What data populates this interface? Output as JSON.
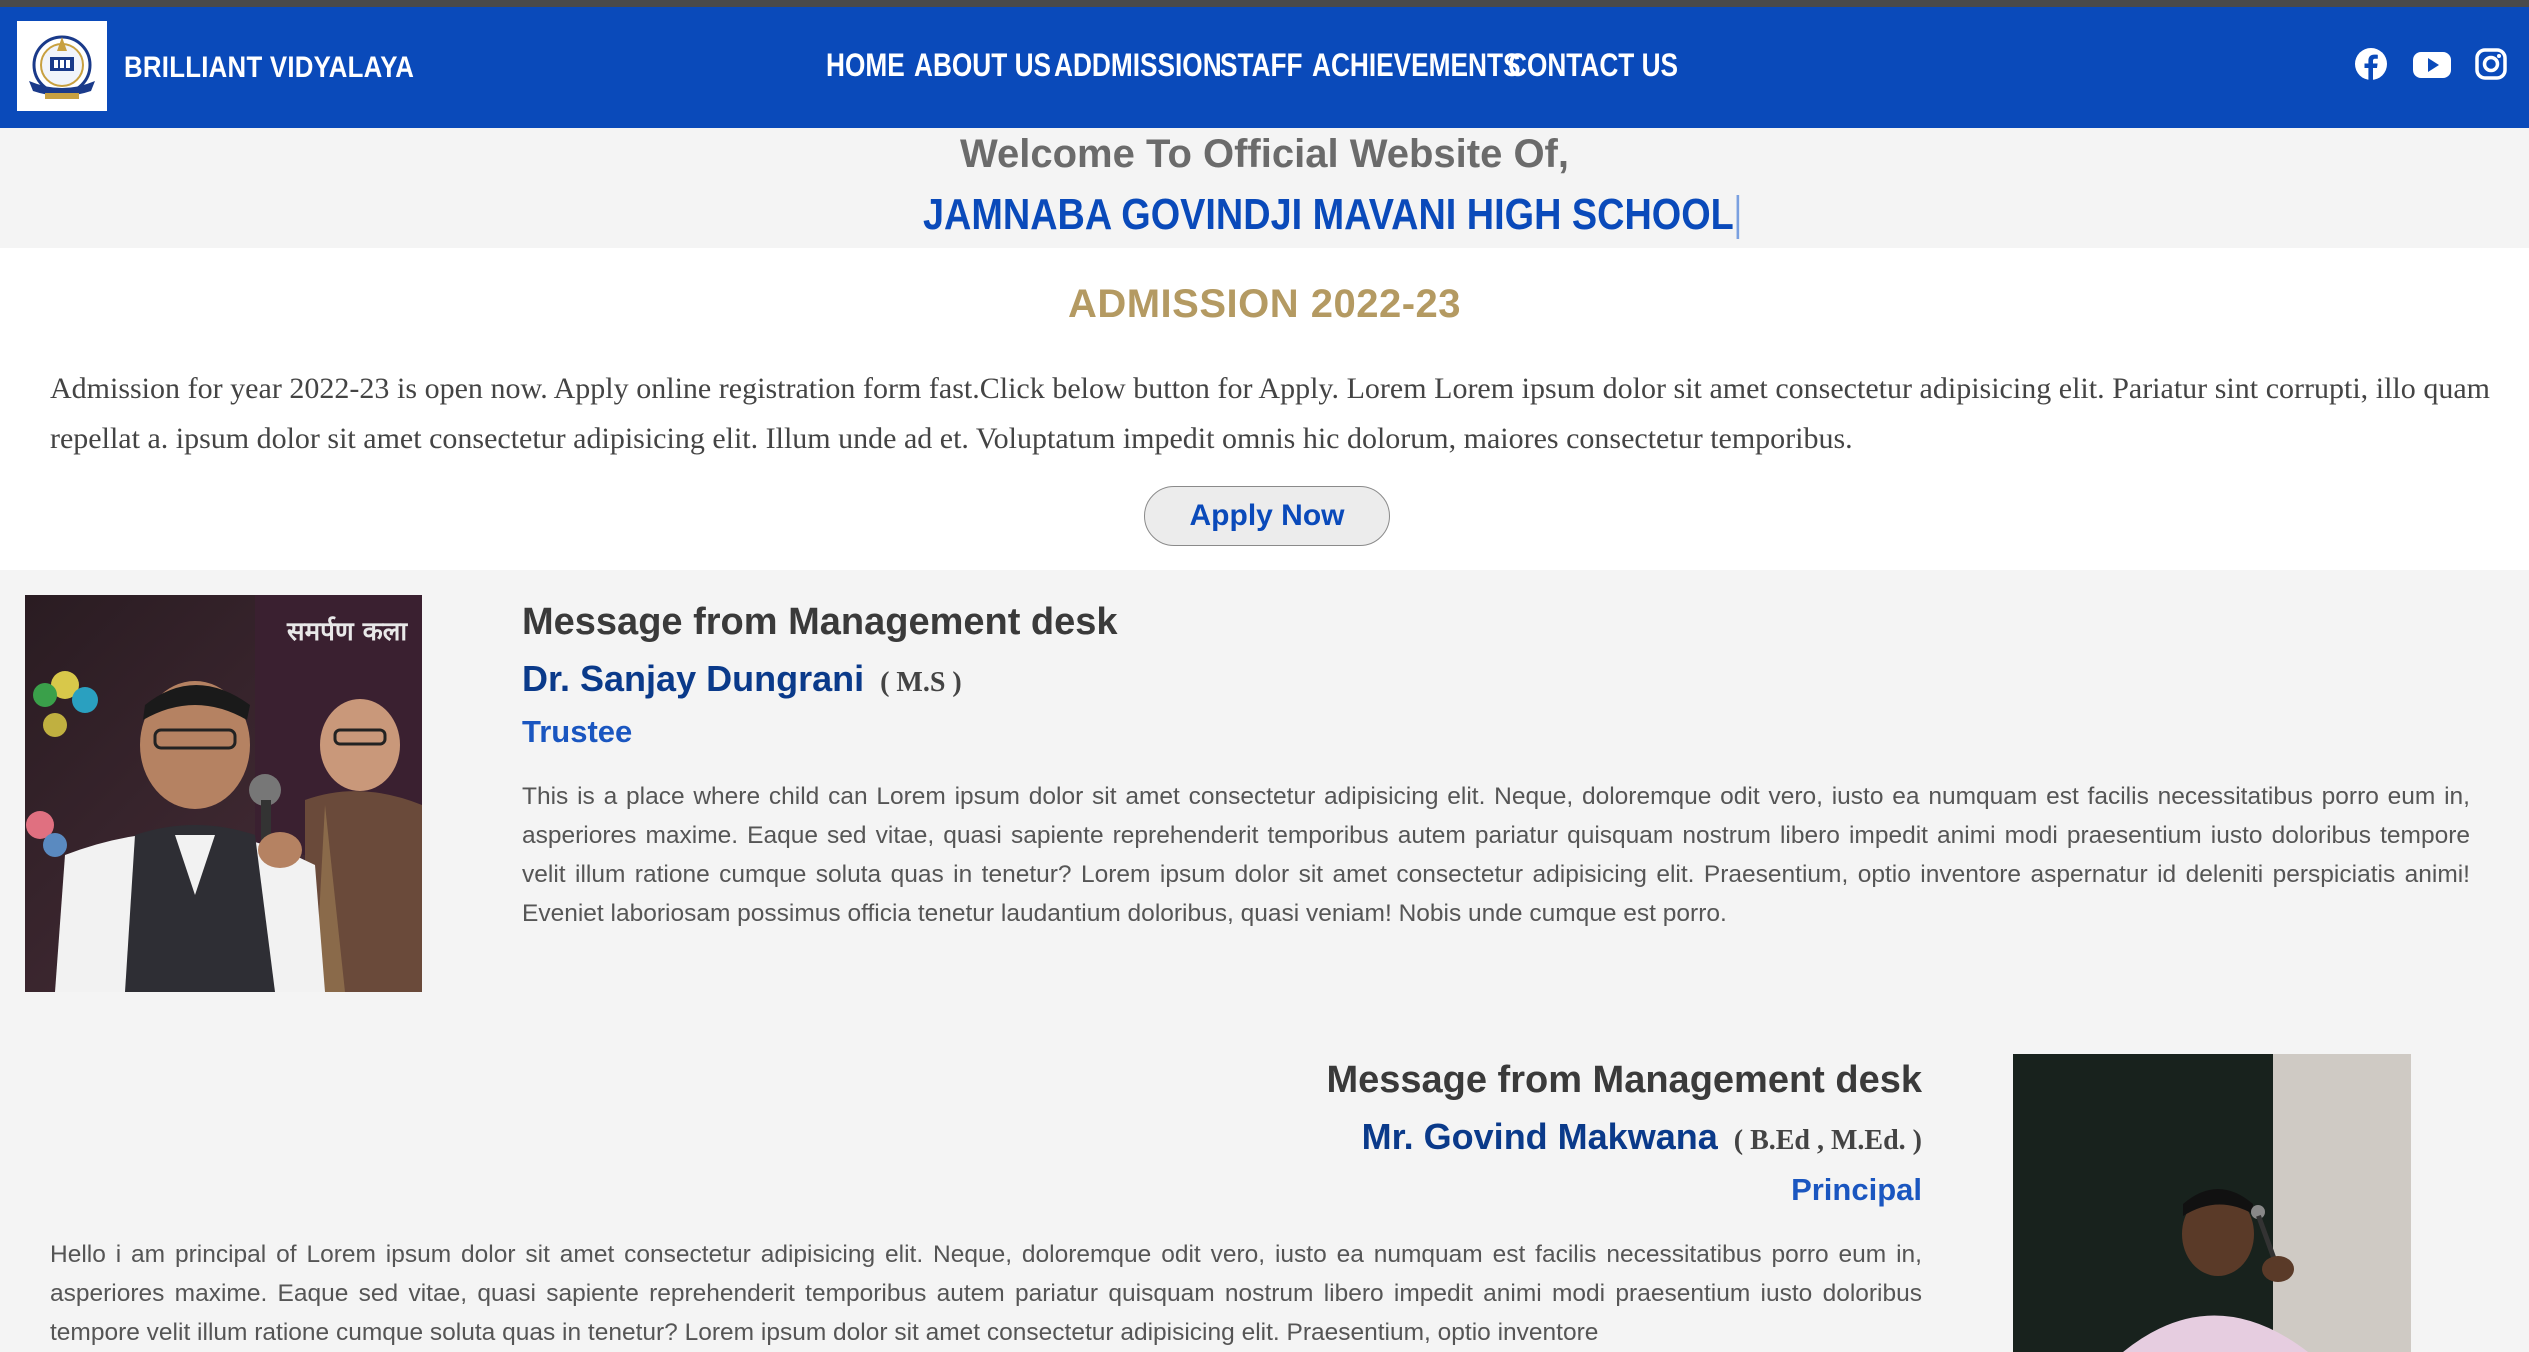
{
  "navbar": {
    "brand": "BRILLIANT VIDYALAYA",
    "logo_icon": "school-crest-logo",
    "menu": [
      "HOME",
      "ABOUT US",
      "ADDMISSION",
      "STAFF",
      "ACHIEVEMENTS",
      "CONTACT US"
    ],
    "social_icons": [
      "facebook-icon",
      "youtube-icon",
      "instagram-icon"
    ],
    "bg_color": "#0a4aba"
  },
  "welcome": {
    "line1": "Welcome To Official Website Of,",
    "line2": "JAMNABA GOVINDJI MAVANI HIGH SCHOOL"
  },
  "admission": {
    "title": "ADMISSION 2022-23",
    "text": "Admission for year 2022-23 is open now. Apply online registration form fast.Click below button for Apply. Lorem Lorem ipsum dolor sit amet consectetur adipisicing elit. Pariatur sint corrupti, illo quam repellat a. ipsum dolor sit amet consectetur adipisicing elit. Illum unde ad et. Voluptatum impedit omnis hic dolorum, maiores consectetur temporibus.",
    "button": "Apply Now"
  },
  "messages": [
    {
      "heading": "Message from Management desk",
      "name": "Dr. Sanjay Dungrani",
      "qualification": "( M.S )",
      "role": "Trustee",
      "body": "This is a place where child can Lorem ipsum dolor sit amet consectetur adipisicing elit. Neque, doloremque odit vero, iusto ea numquam est facilis necessitatibus porro eum in, asperiores maxime. Eaque sed vitae, quasi sapiente reprehenderit temporibus autem pariatur quisquam nostrum libero impedit animi modi praesentium iusto doloribus tempore velit illum ratione cumque soluta quas in tenetur? Lorem ipsum dolor sit amet consectetur adipisicing elit. Praesentium, optio inventore aspernatur id deleniti perspiciatis animi! Eveniet laboriosam possimus officia tenetur laudantium doloribus, quasi veniam! Nobis unde cumque est porro."
    },
    {
      "heading": "Message from Management desk",
      "name": "Mr. Govind Makwana",
      "qualification": "( B.Ed , M.Ed. )",
      "role": "Principal",
      "body": "Hello i am principal of Lorem ipsum dolor sit amet consectetur adipisicing elit. Neque, doloremque odit vero, iusto ea numquam est facilis necessitatibus porro eum in, asperiores maxime. Eaque sed vitae, quasi sapiente reprehenderit temporibus autem pariatur quisquam nostrum libero impedit animi modi praesentium iusto doloribus tempore velit illum ratione cumque soluta quas in tenetur? Lorem ipsum dolor sit amet consectetur adipisicing elit. Praesentium, optio inventore"
    }
  ],
  "photo_banner_text": "समर्पण कला"
}
